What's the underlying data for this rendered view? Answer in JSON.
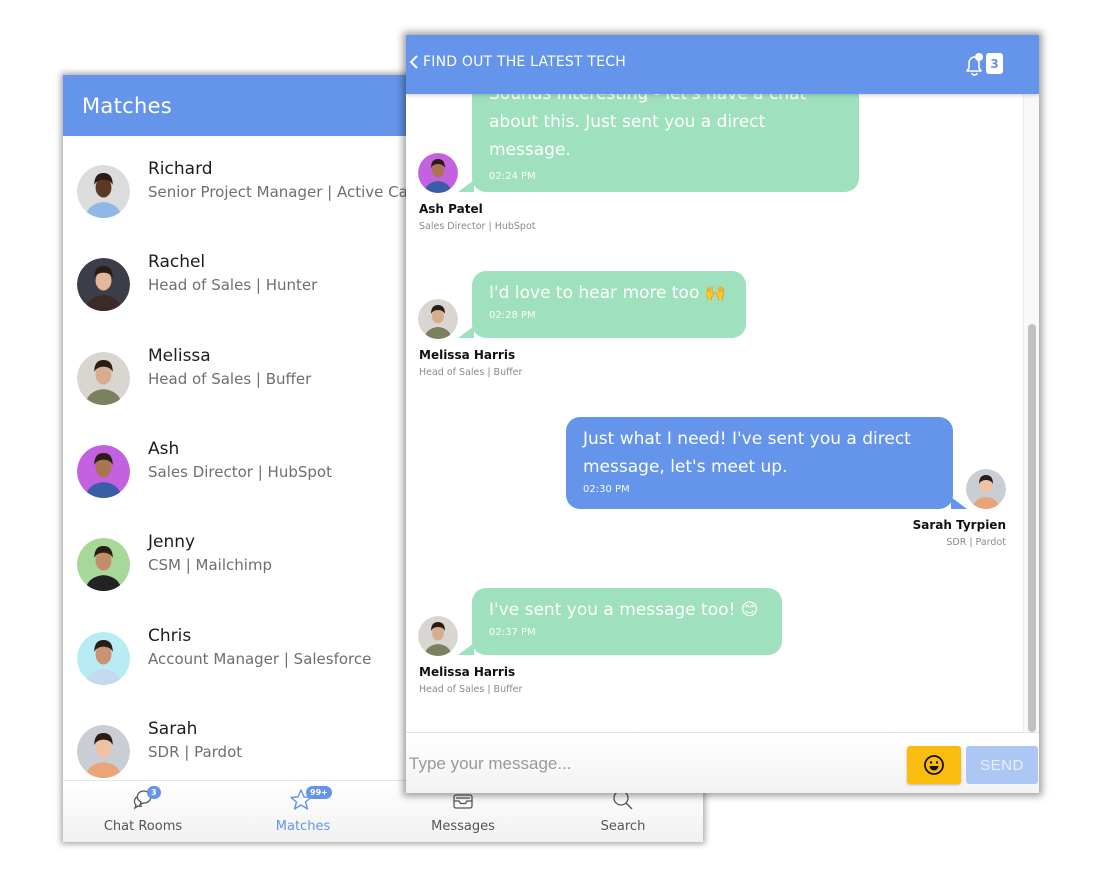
{
  "matches_panel": {
    "title": "Matches",
    "items": [
      {
        "name": "Richard",
        "subtitle": "Senior Project Manager | Active Campaign",
        "avatar_bg": "#dcdcdc",
        "skin": "#5a3a24",
        "shirt": "#8fb8e6"
      },
      {
        "name": "Rachel",
        "subtitle": "Head of Sales | Hunter",
        "avatar_bg": "#3b3d48",
        "skin": "#e5b79a",
        "shirt": "#3a2b26"
      },
      {
        "name": "Melissa",
        "subtitle": "Head of Sales | Buffer",
        "avatar_bg": "#d9d6d2",
        "skin": "#d7ad8f",
        "shirt": "#7b8060"
      },
      {
        "name": "Ash",
        "subtitle": "Sales Director | HubSpot",
        "avatar_bg": "#c361e0",
        "skin": "#a87452",
        "shirt": "#3a5da8"
      },
      {
        "name": "Jenny",
        "subtitle": "CSM | Mailchimp",
        "avatar_bg": "#a7d89a",
        "skin": "#c58c68",
        "shirt": "#222222"
      },
      {
        "name": "Chris",
        "subtitle": "Account Manager | Salesforce",
        "avatar_bg": "#b8ecf5",
        "skin": "#c99274",
        "shirt": "#c6d8ee"
      },
      {
        "name": "Sarah",
        "subtitle": "SDR | Pardot",
        "avatar_bg": "#c9cdd4",
        "skin": "#efc2a5",
        "shirt": "#e9a479"
      }
    ],
    "bottom_nav": [
      {
        "label": "Chat Rooms",
        "icon": "chat-bubbles-icon",
        "badge": "3",
        "active": false
      },
      {
        "label": "Matches",
        "icon": "star-icon",
        "badge": "99+",
        "active": true
      },
      {
        "label": "Messages",
        "icon": "inbox-icon",
        "badge": null,
        "active": false
      },
      {
        "label": "Search",
        "icon": "search-icon",
        "badge": null,
        "active": false
      }
    ]
  },
  "chat_panel": {
    "title": "FIND OUT THE LATEST TECH",
    "back_icon": "chevron-left-icon",
    "notifications": {
      "icon": "bell-icon",
      "count": "3"
    },
    "messages": [
      {
        "direction": "incoming",
        "lines": [
          "Sounds interesting - let's have a chat",
          "about this. Just sent you a direct",
          "message."
        ],
        "time": "02:24 PM",
        "sender": "Ash Patel",
        "role": "Sales Director | HubSpot"
      },
      {
        "direction": "incoming",
        "text": "I'd love to hear more too 🙌",
        "time": "02:28 PM",
        "sender": "Melissa Harris",
        "role": "Head of Sales | Buffer"
      },
      {
        "direction": "outgoing",
        "lines": [
          "Just what I need! I've sent you a direct",
          "message, let's meet up."
        ],
        "time": "02:30 PM",
        "sender": "Sarah Tyrpien",
        "role": "SDR | Pardot"
      },
      {
        "direction": "incoming",
        "text": "I've sent you a message too! 😊",
        "time": "02:37 PM",
        "sender": "Melissa Harris",
        "role": "Head of Sales | Buffer"
      }
    ],
    "composer": {
      "placeholder": "Type your message...",
      "value": "",
      "emoji_icon": "smiley-icon",
      "send_label": "SEND"
    },
    "scroll": {
      "thumb_start_fraction": 0.36,
      "thumb_size_fraction": 0.64
    }
  },
  "colors": {
    "brand_blue": "#6495ea",
    "incoming_bubble": "#9fe0bf",
    "emoji_button": "#fbbd0d",
    "send_button_disabled": "#acc7f3"
  }
}
